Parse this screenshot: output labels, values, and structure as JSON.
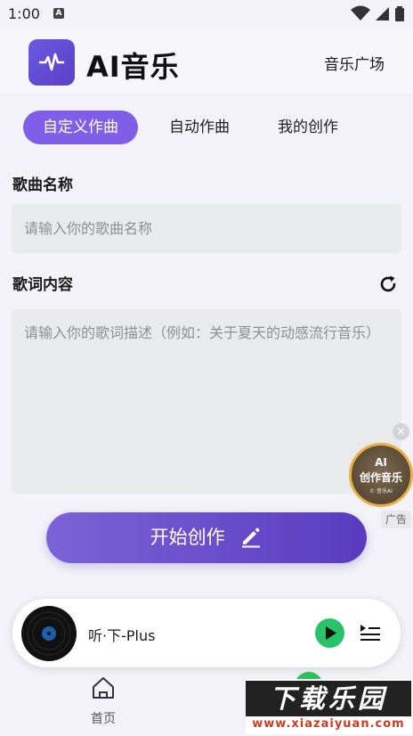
{
  "status_bar": {
    "time": "1:00",
    "notification_badge": "A"
  },
  "header": {
    "app_title": "AI音乐",
    "music_square": "音乐广场"
  },
  "tabs": [
    {
      "label": "自定义作曲",
      "active": true
    },
    {
      "label": "自动作曲",
      "active": false
    },
    {
      "label": "我的创作",
      "active": false
    }
  ],
  "form": {
    "song_name_label": "歌曲名称",
    "song_name_placeholder": "请输入你的歌曲名称",
    "song_name_value": "",
    "lyrics_label": "歌词内容",
    "lyrics_placeholder": "请输入你的歌词描述（例如：关于夏天的动感流行音乐）",
    "lyrics_value": ""
  },
  "start_button": {
    "label": "开始创作"
  },
  "floating_ad": {
    "line1": "AI",
    "line2": "创作音乐",
    "line3": "© 音乐AI",
    "tag": "广告",
    "close": "×"
  },
  "player": {
    "track_title": "听·下-Plus"
  },
  "bottom_nav": {
    "home_label": "首页"
  },
  "watermark": {
    "top": "下载乐园",
    "bottom": "www.xiazaiyuan.com"
  },
  "colors": {
    "accent": "#7f5fe8",
    "button_gradient_start": "#7c62d8",
    "button_gradient_end": "#5a3bbf",
    "play_green": "#27c26a",
    "background": "#f3f2f8"
  }
}
